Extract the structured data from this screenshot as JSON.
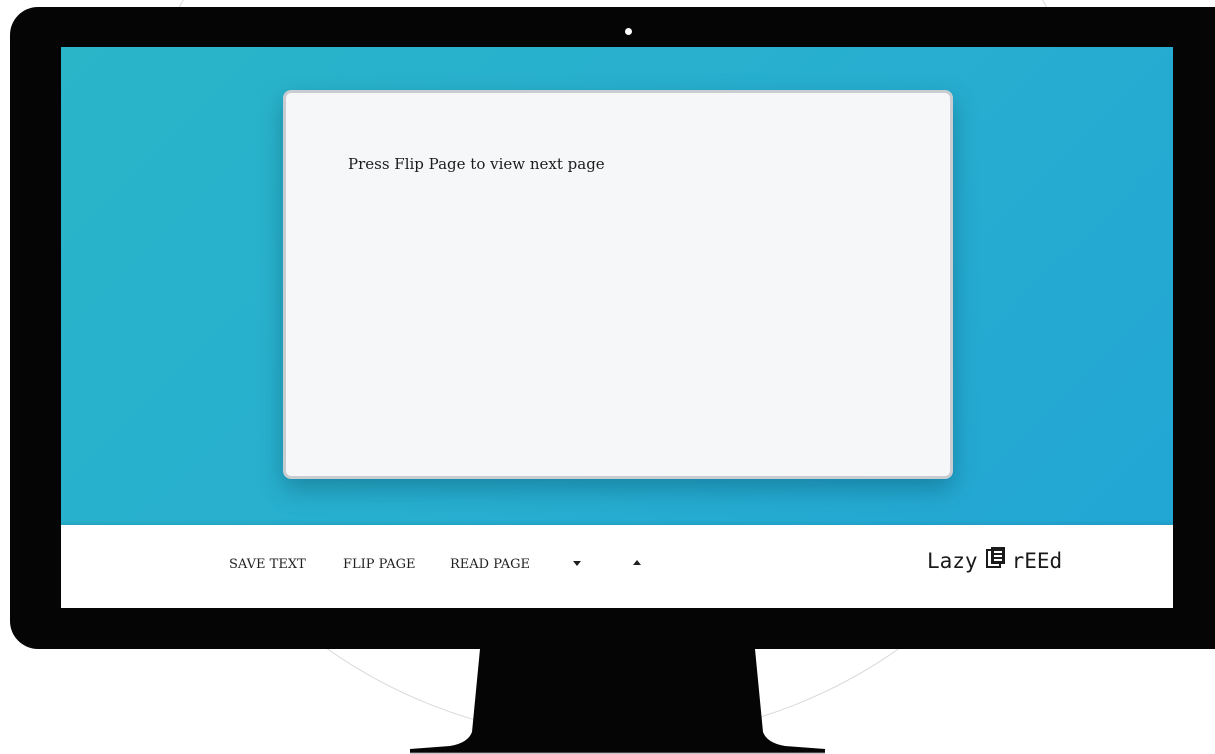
{
  "page": {
    "content_text": "Press Flip Page to view next page"
  },
  "toolbar": {
    "save_label": "SAVE TEXT",
    "flip_label": "FLIP PAGE",
    "read_label": "READ PAGE",
    "down_icon": "caret-down-icon",
    "up_icon": "caret-up-icon"
  },
  "brand": {
    "left": "Lazy",
    "icon": "book-icon",
    "right": "rEEd"
  },
  "colors": {
    "viewer_bg": "#27aed0",
    "page_bg": "#f6f7f8",
    "toolbar_bg": "#ffffff",
    "monitor": "#050505"
  }
}
